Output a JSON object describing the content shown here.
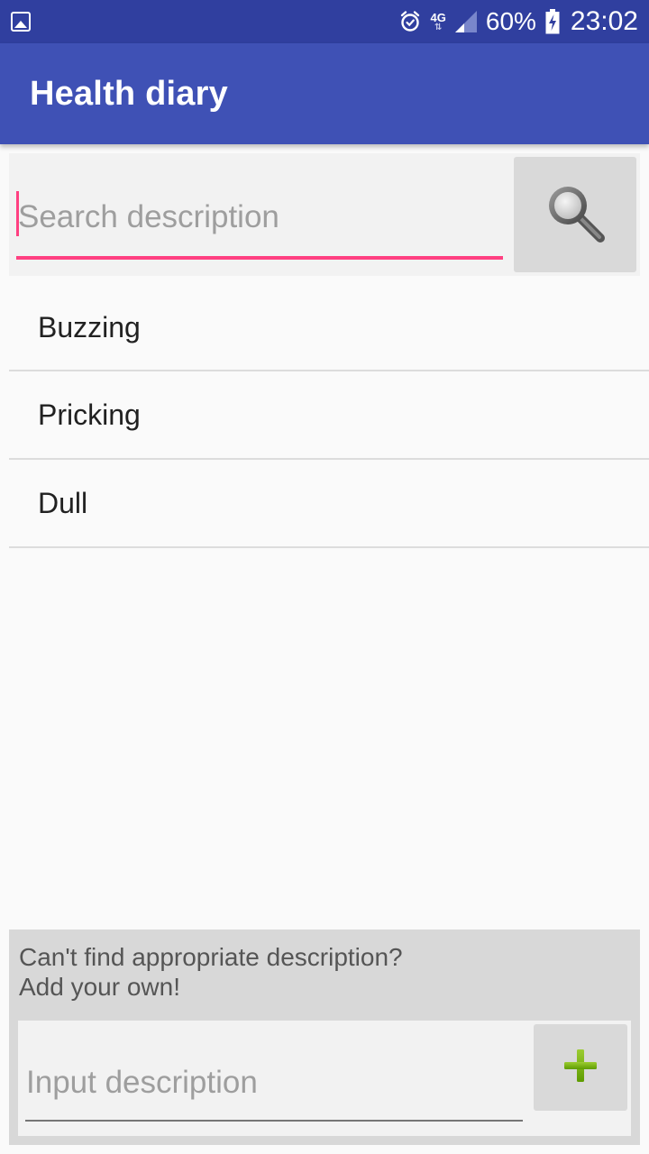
{
  "status_bar": {
    "network_label": "4G",
    "network_arrows": "⇅",
    "battery_percent": "60%",
    "time": "23:02",
    "icons": [
      "gallery-icon",
      "alarm-icon",
      "signal-icon",
      "battery-charging-icon"
    ]
  },
  "app_bar": {
    "title": "Health diary"
  },
  "search": {
    "placeholder": "Search description",
    "value": "",
    "button_icon": "search-icon"
  },
  "list": {
    "items": [
      {
        "label": "Buzzing"
      },
      {
        "label": "Pricking"
      },
      {
        "label": "Dull"
      }
    ]
  },
  "bottom_panel": {
    "hint_line1": "Can't find appropriate description?",
    "hint_line2": "Add your own!",
    "input_placeholder": "Input description",
    "add_button_icon": "plus-icon"
  },
  "colors": {
    "status_bar": "#303f9f",
    "app_bar": "#3f51b5",
    "accent": "#ff4081",
    "plus_green": "#7cb300"
  }
}
